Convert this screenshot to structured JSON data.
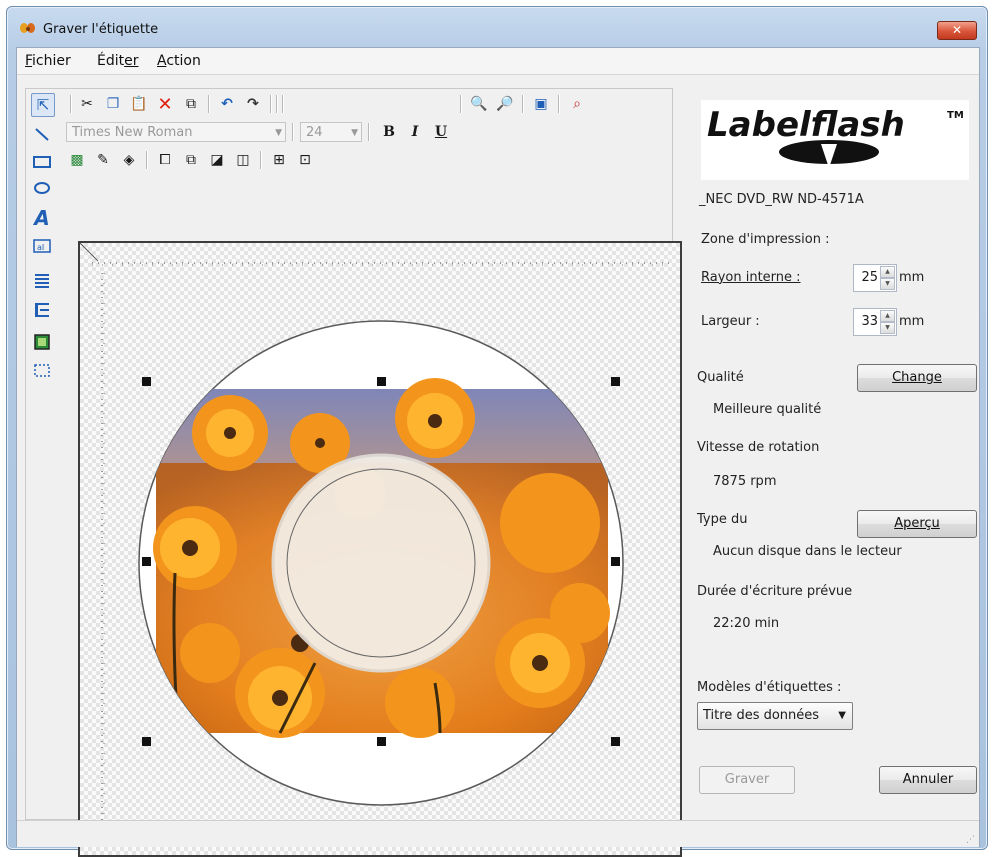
{
  "window": {
    "title": "Graver l'étiquette",
    "close_glyph": "✕"
  },
  "menu": [
    {
      "label": "Fichier",
      "accel": "F",
      "rest": "ichier"
    },
    {
      "label": "Éditer",
      "accel": "Édit",
      "rest": "er"
    },
    {
      "label": "Action",
      "accel": "A",
      "rest": "ction"
    }
  ],
  "toolbar": {
    "font_family": "Times New Roman",
    "font_size": "24",
    "bold_label": "B",
    "italic_label": "I",
    "underline_label": "U"
  },
  "logo": {
    "text": "Labelflash",
    "tm": "TM"
  },
  "drive": "_NEC DVD_RW ND-4571A",
  "print_zone": {
    "label": "Zone d'impression :",
    "inner_radius_label": "Rayon interne :",
    "inner_radius_value": "25",
    "width_label": "Largeur :",
    "width_value": "33",
    "unit": "mm"
  },
  "quality": {
    "label": "Qualité",
    "value": "Meilleure qualité",
    "button": "Change"
  },
  "rotation": {
    "label": "Vitesse de rotation",
    "value": "7875 rpm"
  },
  "disc_type": {
    "label": "Type du",
    "value": "Aucun disque dans le lecteur",
    "button": "Aperçu"
  },
  "duration": {
    "label": "Durée d'écriture prévue",
    "value": "22:20 min"
  },
  "templates": {
    "label": "Modèles d'étiquettes :",
    "selected": "Titre des données"
  },
  "actions": {
    "burn": "Graver",
    "cancel": "Annuler"
  },
  "colors": {
    "accent": "#1f5fb5",
    "close": "#d9553a",
    "flower": "#f08a1a"
  }
}
